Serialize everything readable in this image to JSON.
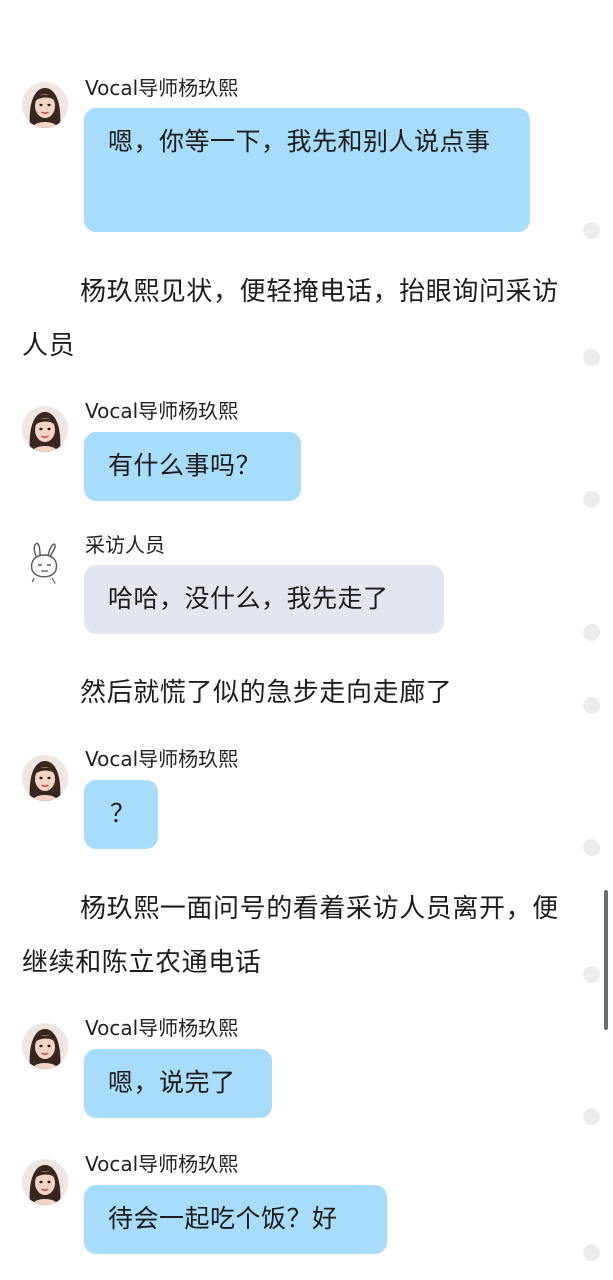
{
  "messages": [
    {
      "speaker": "Vocal导师杨玖熙",
      "text": "嗯，你等一下，我先和别人说点事"
    },
    {
      "speaker": "Vocal导师杨玖熙",
      "text": "有什么事吗？"
    },
    {
      "speaker": "采访人员",
      "text": "哈哈，没什么，我先走了"
    },
    {
      "speaker": "Vocal导师杨玖熙",
      "text": "？"
    },
    {
      "speaker": "Vocal导师杨玖熙",
      "text": "嗯，说完了"
    },
    {
      "speaker": "Vocal导师杨玖熙",
      "text": "待会一起吃个饭？好"
    }
  ],
  "narration": [
    "杨玖熙见状，便轻掩电话，抬眼询问采访人员",
    "然后就慌了似的急步走向走廊了",
    "杨玖熙一面问号的看着采访人员离开，便继续和陈立农通电话"
  ],
  "colors": {
    "teacher_bubble": "#a8dcfb",
    "interviewer_bubble": "#e3e6ef"
  },
  "icons": {
    "teacher_avatar": "avatar-woman",
    "interviewer_avatar": "rabbit-doodle-avatar",
    "reaction_dot": "dot-icon"
  }
}
